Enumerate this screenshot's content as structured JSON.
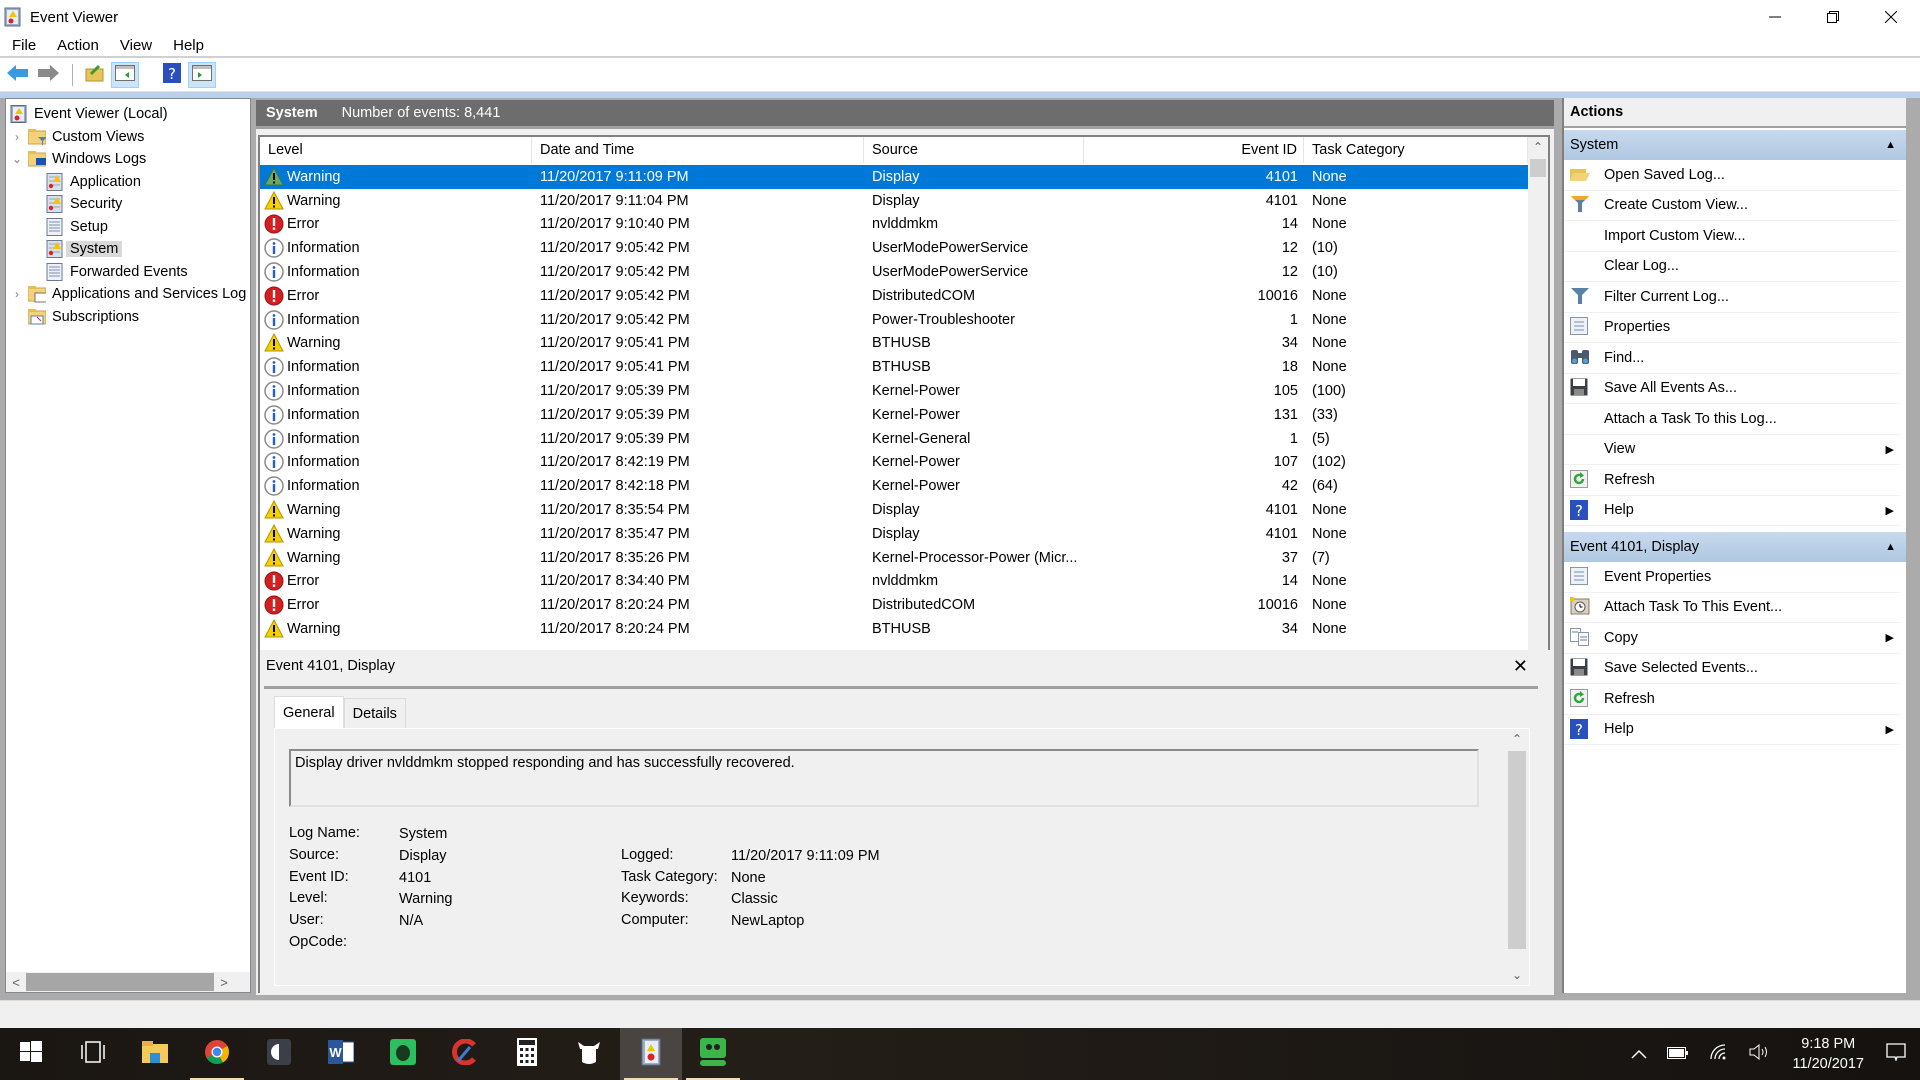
{
  "window": {
    "title": "Event Viewer",
    "app_icon": "event-viewer-icon",
    "controls": [
      "minimize",
      "restore",
      "close"
    ]
  },
  "menu": [
    "File",
    "Action",
    "View",
    "Help"
  ],
  "toolbar": {
    "buttons": [
      "back-arrow-icon",
      "forward-arrow-icon",
      "up-folder-icon",
      "show-hide-console-tree-icon",
      "help-icon",
      "show-hide-action-pane-icon"
    ]
  },
  "tree": {
    "items": [
      {
        "label": "Event Viewer (Local)",
        "level": 0,
        "expander": "",
        "icon": "event-viewer-icon"
      },
      {
        "label": "Custom Views",
        "level": 1,
        "expander": "›",
        "icon": "folder-filter-icon"
      },
      {
        "label": "Windows Logs",
        "level": 1,
        "expander": "⌄",
        "icon": "folder-windows-icon"
      },
      {
        "label": "Application",
        "level": 2,
        "expander": "",
        "icon": "log-warning-icon"
      },
      {
        "label": "Security",
        "level": 2,
        "expander": "",
        "icon": "log-warning-icon"
      },
      {
        "label": "Setup",
        "level": 2,
        "expander": "",
        "icon": "log-plain-icon"
      },
      {
        "label": "System",
        "level": 2,
        "expander": "",
        "icon": "log-warning-icon",
        "selected": true
      },
      {
        "label": "Forwarded Events",
        "level": 2,
        "expander": "",
        "icon": "log-plain-icon"
      },
      {
        "label": "Applications and Services Log",
        "level": 1,
        "expander": "›",
        "icon": "folder-window-icon"
      },
      {
        "label": "Subscriptions",
        "level": 1,
        "expander": "",
        "icon": "subscriptions-icon"
      }
    ]
  },
  "center": {
    "log_name": "System",
    "event_count": "Number of events: 8,441",
    "columns": [
      "Level",
      "Date and Time",
      "Source",
      "Event ID",
      "Task Category"
    ],
    "rows": [
      {
        "level": "Warning",
        "date": "11/20/2017 9:11:09 PM",
        "source": "Display",
        "id": "4101",
        "task": "None",
        "selected": true
      },
      {
        "level": "Warning",
        "date": "11/20/2017 9:11:04 PM",
        "source": "Display",
        "id": "4101",
        "task": "None"
      },
      {
        "level": "Error",
        "date": "11/20/2017 9:10:40 PM",
        "source": "nvlddmkm",
        "id": "14",
        "task": "None"
      },
      {
        "level": "Information",
        "date": "11/20/2017 9:05:42 PM",
        "source": "UserModePowerService",
        "id": "12",
        "task": "(10)"
      },
      {
        "level": "Information",
        "date": "11/20/2017 9:05:42 PM",
        "source": "UserModePowerService",
        "id": "12",
        "task": "(10)"
      },
      {
        "level": "Error",
        "date": "11/20/2017 9:05:42 PM",
        "source": "DistributedCOM",
        "id": "10016",
        "task": "None"
      },
      {
        "level": "Information",
        "date": "11/20/2017 9:05:42 PM",
        "source": "Power-Troubleshooter",
        "id": "1",
        "task": "None"
      },
      {
        "level": "Warning",
        "date": "11/20/2017 9:05:41 PM",
        "source": "BTHUSB",
        "id": "34",
        "task": "None"
      },
      {
        "level": "Information",
        "date": "11/20/2017 9:05:41 PM",
        "source": "BTHUSB",
        "id": "18",
        "task": "None"
      },
      {
        "level": "Information",
        "date": "11/20/2017 9:05:39 PM",
        "source": "Kernel-Power",
        "id": "105",
        "task": "(100)"
      },
      {
        "level": "Information",
        "date": "11/20/2017 9:05:39 PM",
        "source": "Kernel-Power",
        "id": "131",
        "task": "(33)"
      },
      {
        "level": "Information",
        "date": "11/20/2017 9:05:39 PM",
        "source": "Kernel-General",
        "id": "1",
        "task": "(5)"
      },
      {
        "level": "Information",
        "date": "11/20/2017 8:42:19 PM",
        "source": "Kernel-Power",
        "id": "107",
        "task": "(102)"
      },
      {
        "level": "Information",
        "date": "11/20/2017 8:42:18 PM",
        "source": "Kernel-Power",
        "id": "42",
        "task": "(64)"
      },
      {
        "level": "Warning",
        "date": "11/20/2017 8:35:54 PM",
        "source": "Display",
        "id": "4101",
        "task": "None"
      },
      {
        "level": "Warning",
        "date": "11/20/2017 8:35:47 PM",
        "source": "Display",
        "id": "4101",
        "task": "None"
      },
      {
        "level": "Warning",
        "date": "11/20/2017 8:35:26 PM",
        "source": "Kernel-Processor-Power (Micr...",
        "id": "37",
        "task": "(7)"
      },
      {
        "level": "Error",
        "date": "11/20/2017 8:34:40 PM",
        "source": "nvlddmkm",
        "id": "14",
        "task": "None"
      },
      {
        "level": "Error",
        "date": "11/20/2017 8:20:24 PM",
        "source": "DistributedCOM",
        "id": "10016",
        "task": "None"
      },
      {
        "level": "Warning",
        "date": "11/20/2017 8:20:24 PM",
        "source": "BTHUSB",
        "id": "34",
        "task": "None"
      }
    ]
  },
  "detail": {
    "title": "Event 4101, Display",
    "tabs": [
      "General",
      "Details"
    ],
    "active_tab": "General",
    "description": "Display driver nvlddmkm stopped responding and has successfully recovered.",
    "props_left": [
      {
        "label": "Log Name:",
        "value": "System"
      },
      {
        "label": "Source:",
        "value": "Display"
      },
      {
        "label": "Event ID:",
        "value": "4101"
      },
      {
        "label": "Level:",
        "value": "Warning"
      },
      {
        "label": "User:",
        "value": "N/A"
      },
      {
        "label": "OpCode:",
        "value": ""
      }
    ],
    "props_right": [
      {
        "label": "Logged:",
        "value": "11/20/2017 9:11:09 PM"
      },
      {
        "label": "Task Category:",
        "value": "None"
      },
      {
        "label": "Keywords:",
        "value": "Classic"
      },
      {
        "label": "Computer:",
        "value": "NewLaptop"
      }
    ]
  },
  "actions": {
    "title": "Actions",
    "sections": [
      {
        "header": "System",
        "items": [
          {
            "label": "Open Saved Log...",
            "icon": "open-folder-icon"
          },
          {
            "label": "Create Custom View...",
            "icon": "filter-create-icon"
          },
          {
            "label": "Import Custom View...",
            "icon": ""
          },
          {
            "label": "Clear Log...",
            "icon": ""
          },
          {
            "label": "Filter Current Log...",
            "icon": "filter-icon"
          },
          {
            "label": "Properties",
            "icon": "properties-icon"
          },
          {
            "label": "Find...",
            "icon": "binoculars-icon"
          },
          {
            "label": "Save All Events As...",
            "icon": "save-icon"
          },
          {
            "label": "Attach a Task To this Log...",
            "icon": ""
          },
          {
            "label": "View",
            "icon": "",
            "submenu": true
          },
          {
            "label": "Refresh",
            "icon": "refresh-icon"
          },
          {
            "label": "Help",
            "icon": "help-icon",
            "submenu": true
          }
        ]
      },
      {
        "header": "Event 4101, Display",
        "items": [
          {
            "label": "Event Properties",
            "icon": "properties-icon"
          },
          {
            "label": "Attach Task To This Event...",
            "icon": "task-clock-icon"
          },
          {
            "label": "Copy",
            "icon": "copy-icon",
            "submenu": true
          },
          {
            "label": "Save Selected Events...",
            "icon": "save-icon"
          },
          {
            "label": "Refresh",
            "icon": "refresh-icon"
          },
          {
            "label": "Help",
            "icon": "help-icon",
            "submenu": true
          }
        ]
      }
    ]
  },
  "taskbar": {
    "apps": [
      "start-icon",
      "task-view-icon",
      "file-explorer-icon",
      "chrome-icon",
      "audio-app-icon",
      "word-icon",
      "evernote-icon",
      "ccleaner-icon",
      "calculator-icon",
      "cow-app-icon",
      "event-viewer-icon",
      "roboform-icon"
    ],
    "time": "9:18 PM",
    "date": "11/20/2017"
  },
  "colors": {
    "selection": "#0078d7",
    "section_header": "#b9d1ea",
    "center_header": "#6d6d6d"
  }
}
